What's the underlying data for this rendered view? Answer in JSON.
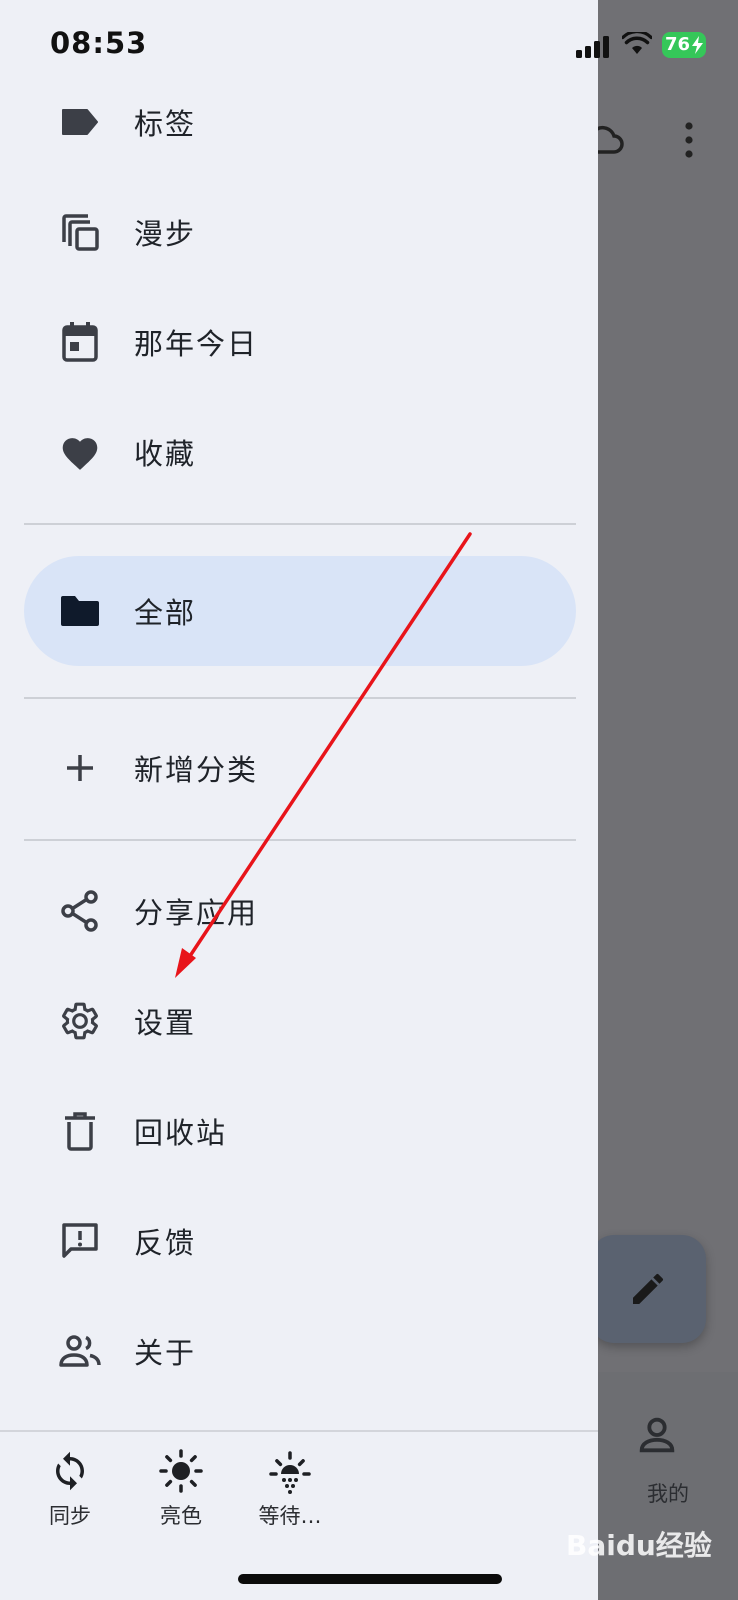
{
  "status_bar": {
    "time": "08:53",
    "battery": "76"
  },
  "nav": [
    {
      "label": "标签",
      "icon": "label-icon"
    },
    {
      "label": "漫步",
      "icon": "copy-stack-icon"
    },
    {
      "label": "那年今日",
      "icon": "calendar-icon"
    },
    {
      "label": "收藏",
      "icon": "heart-icon"
    },
    {
      "label": "全部",
      "icon": "folder-icon",
      "active": true
    },
    {
      "label": "新增分类",
      "icon": "plus-icon"
    },
    {
      "label": "分享应用",
      "icon": "share-icon"
    },
    {
      "label": "设置",
      "icon": "gear-icon"
    },
    {
      "label": "回收站",
      "icon": "trash-icon"
    },
    {
      "label": "反馈",
      "icon": "feedback-icon"
    },
    {
      "label": "关于",
      "icon": "people-icon"
    }
  ],
  "bottom_tools": [
    {
      "label": "同步",
      "icon": "sync-icon"
    },
    {
      "label": "亮色",
      "icon": "sun-icon"
    },
    {
      "label": "等待…",
      "icon": "sunset-icon"
    }
  ],
  "background_app": {
    "tab_me_label": "我的"
  },
  "watermark": "Baidu经验",
  "colors": {
    "drawer_bg": "#eef0f6",
    "active_pill": "#d9e4f7",
    "annotation": "#e8141a"
  }
}
